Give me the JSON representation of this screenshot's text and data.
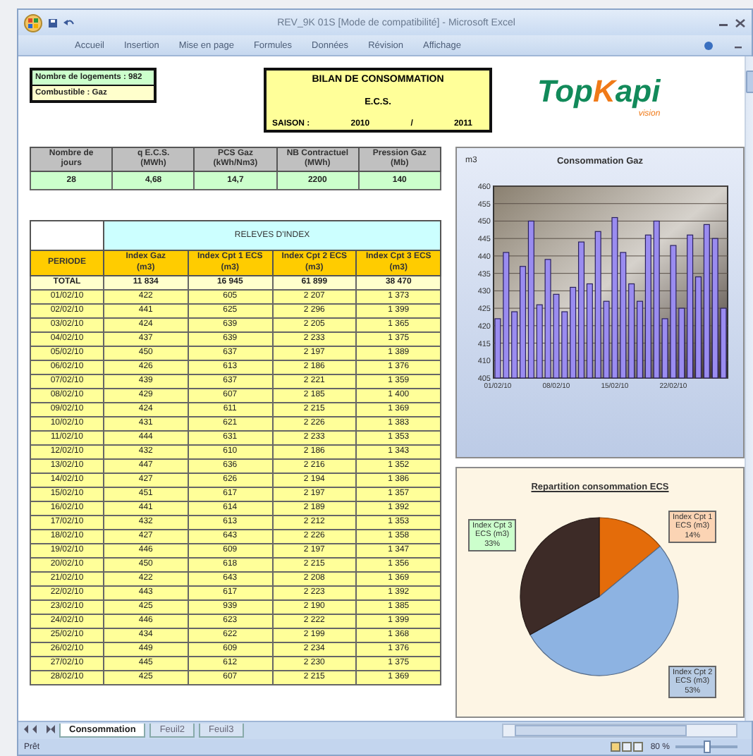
{
  "window": {
    "title": "REV_9K 01S [Mode de compatibilité] - Microsoft Excel",
    "menu": [
      "Accueil",
      "Insertion",
      "Mise en page",
      "Formules",
      "Données",
      "Révision",
      "Affichage"
    ]
  },
  "info_lines": [
    {
      "text": "Nombre de logements : 982",
      "color": "#ccffcc"
    },
    {
      "text": "Combustible : Gaz",
      "color": "#ffffcc"
    }
  ],
  "report": {
    "title": "BILAN DE CONSOMMATION",
    "subtitle": "E.C.S.",
    "season_label": "SAISON :",
    "year_start": "2010",
    "separator": "/",
    "year_end": "2011"
  },
  "logo": {
    "parts": [
      {
        "text": "Top",
        "color": "#128a5a"
      },
      {
        "text": "K",
        "color": "#f07a18"
      },
      {
        "text": "api",
        "color": "#128a5a"
      }
    ],
    "tagline": "vision"
  },
  "parameters": {
    "columns": [
      "Nombre de\njours",
      "q E.C.S.\n(MWh)",
      "PCS Gaz\n(kWh/Nm3)",
      "NB Contractuel\n(MWh)",
      "Pression Gaz\n(Mb)"
    ],
    "values": [
      "28",
      "4,68",
      "14,7",
      "2200",
      "140"
    ]
  },
  "readings": {
    "group_header": "RELEVES D'INDEX",
    "columns": [
      "PERIODE",
      "Index Gaz\n(m3)",
      "Index Cpt 1 ECS\n(m3)",
      "Index Cpt 2 ECS\n(m3)",
      "Index Cpt 3 ECS\n(m3)"
    ],
    "total": [
      "TOTAL",
      "11 834",
      "16 945",
      "61 899",
      "38 470"
    ],
    "rows": [
      [
        "01/02/10",
        "422",
        "605",
        "2 207",
        "1 373"
      ],
      [
        "02/02/10",
        "441",
        "625",
        "2 296",
        "1 399"
      ],
      [
        "03/02/10",
        "424",
        "639",
        "2 205",
        "1 365"
      ],
      [
        "04/02/10",
        "437",
        "639",
        "2 233",
        "1 375"
      ],
      [
        "05/02/10",
        "450",
        "637",
        "2 197",
        "1 389"
      ],
      [
        "06/02/10",
        "426",
        "613",
        "2 186",
        "1 376"
      ],
      [
        "07/02/10",
        "439",
        "637",
        "2 221",
        "1 359"
      ],
      [
        "08/02/10",
        "429",
        "607",
        "2 185",
        "1 400"
      ],
      [
        "09/02/10",
        "424",
        "611",
        "2 215",
        "1 369"
      ],
      [
        "10/02/10",
        "431",
        "621",
        "2 226",
        "1 383"
      ],
      [
        "11/02/10",
        "444",
        "631",
        "2 233",
        "1 353"
      ],
      [
        "12/02/10",
        "432",
        "610",
        "2 186",
        "1 343"
      ],
      [
        "13/02/10",
        "447",
        "636",
        "2 216",
        "1 352"
      ],
      [
        "14/02/10",
        "427",
        "626",
        "2 194",
        "1 386"
      ],
      [
        "15/02/10",
        "451",
        "617",
        "2 197",
        "1 357"
      ],
      [
        "16/02/10",
        "441",
        "614",
        "2 189",
        "1 392"
      ],
      [
        "17/02/10",
        "432",
        "613",
        "2 212",
        "1 353"
      ],
      [
        "18/02/10",
        "427",
        "643",
        "2 226",
        "1 358"
      ],
      [
        "19/02/10",
        "446",
        "609",
        "2 197",
        "1 347"
      ],
      [
        "20/02/10",
        "450",
        "618",
        "2 215",
        "1 356"
      ],
      [
        "21/02/10",
        "422",
        "643",
        "2 208",
        "1 369"
      ],
      [
        "22/02/10",
        "443",
        "617",
        "2 223",
        "1 392"
      ],
      [
        "23/02/10",
        "425",
        "939",
        "2 190",
        "1 385"
      ],
      [
        "24/02/10",
        "446",
        "623",
        "2 222",
        "1 399"
      ],
      [
        "25/02/10",
        "434",
        "622",
        "2 199",
        "1 368"
      ],
      [
        "26/02/10",
        "449",
        "609",
        "2 234",
        "1 376"
      ],
      [
        "27/02/10",
        "445",
        "612",
        "2 230",
        "1 375"
      ],
      [
        "28/02/10",
        "425",
        "607",
        "2 215",
        "1 369"
      ]
    ]
  },
  "gas_chart": {
    "chart_data": {
      "type": "bar",
      "title": "Consommation Gaz",
      "ylabel": "m3",
      "categories": [
        "01/02/10",
        null,
        null,
        null,
        null,
        null,
        null,
        "08/02/10",
        null,
        null,
        null,
        null,
        null,
        null,
        "15/02/10",
        null,
        null,
        null,
        null,
        null,
        null,
        "22/02/10",
        null,
        null,
        null,
        null,
        null,
        null
      ],
      "values": [
        422,
        441,
        424,
        437,
        450,
        426,
        439,
        429,
        424,
        431,
        444,
        432,
        447,
        427,
        451,
        441,
        432,
        427,
        446,
        450,
        422,
        443,
        425,
        446,
        434,
        449,
        445,
        425
      ],
      "ylim": [
        405,
        460
      ],
      "yticks": [
        405,
        410,
        415,
        420,
        425,
        430,
        435,
        440,
        445,
        450,
        455,
        460
      ],
      "grid": true
    }
  },
  "ecs_chart": {
    "chart_data": {
      "type": "pie",
      "title": "Repartition consommation ECS",
      "categories": [
        "Index Cpt 1\nECS (m3)",
        "Index Cpt 2\nECS (m3)",
        "Index Cpt 3\nECS (m3)"
      ],
      "values": [
        14,
        53,
        33
      ],
      "colors": [
        "#e46c0a",
        "#8db3e2",
        "#3d2b27"
      ],
      "value_labels": [
        "14%",
        "53%",
        "33%"
      ]
    }
  },
  "sheet_tabs": [
    {
      "label": "Consommation",
      "selected": true
    },
    {
      "label": "Feuil2",
      "selected": false
    },
    {
      "label": "Feuil3",
      "selected": false
    }
  ],
  "status_bar": {
    "text": "Prêt",
    "zoom": "80 %",
    "zoom_slider": {
      "level": 0.5
    }
  }
}
